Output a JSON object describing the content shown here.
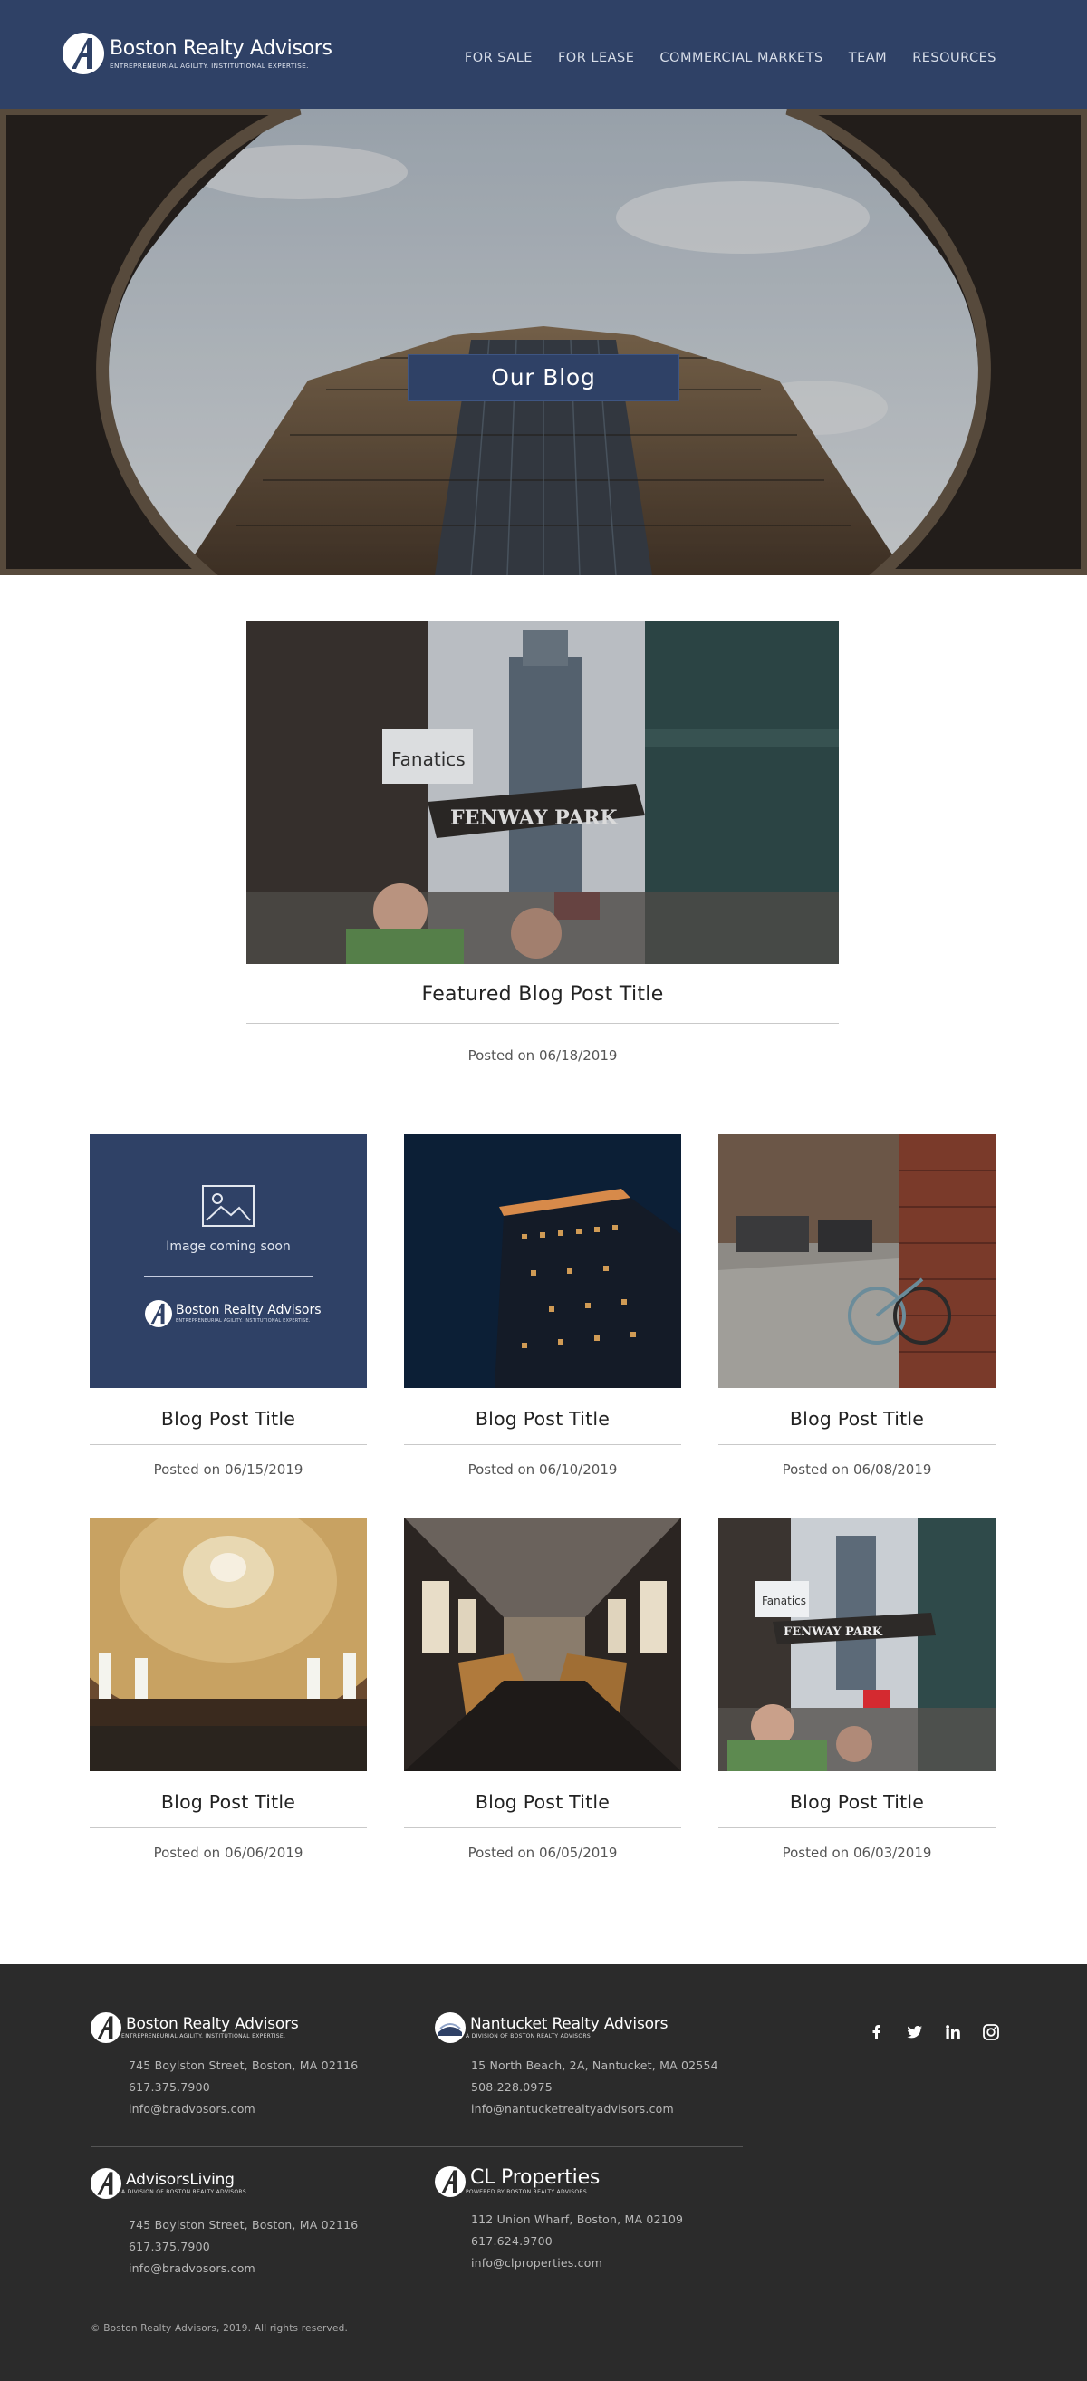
{
  "header": {
    "brand_name": "Boston Realty Advisors",
    "brand_tagline": "ENTREPRENEURIAL AGILITY. INSTITUTIONAL EXPERTISE.",
    "nav": [
      "FOR SALE",
      "FOR LEASE",
      "COMMERCIAL MARKETS",
      "TEAM",
      "RESOURCES"
    ]
  },
  "hero": {
    "title": "Our Blog"
  },
  "featured": {
    "title": "Featured Blog Post Title",
    "date": "Posted on 06/18/2019"
  },
  "posts": [
    {
      "title": "Blog Post Title",
      "date": "Posted on 06/15/2019",
      "image": "image-coming-soon-placeholder"
    },
    {
      "title": "Blog Post Title",
      "date": "Posted on 06/10/2019",
      "image": "night-building-photo"
    },
    {
      "title": "Blog Post Title",
      "date": "Posted on 06/08/2019",
      "image": "bicycle-alley-photo"
    },
    {
      "title": "Blog Post Title",
      "date": "Posted on 06/06/2019",
      "image": "domed-hall-photo"
    },
    {
      "title": "Blog Post Title",
      "date": "Posted on 06/05/2019",
      "image": "train-interior-photo"
    },
    {
      "title": "Blog Post Title",
      "date": "Posted on 06/03/2019",
      "image": "fenway-street-photo"
    }
  ],
  "placeholder": {
    "text": "Image coming soon",
    "brand_name": "Boston Realty Advisors",
    "brand_tagline": "ENTREPRENEURIAL AGILITY. INSTITUTIONAL EXPERTISE."
  },
  "footer": {
    "bra": {
      "name": "Boston Realty Advisors",
      "sub": "ENTREPRENEURIAL AGILITY. INSTITUTIONAL EXPERTISE.",
      "address": "745 Boylston Street, Boston, MA 02116",
      "phone": "617.375.7900",
      "email": "info@bradvosors.com"
    },
    "nra": {
      "name": "Nantucket Realty Advisors",
      "sub": "A DIVISION OF BOSTON REALTY ADVISORS",
      "address": "15 North Beach, 2A, Nantucket, MA 02554",
      "phone": "508.228.0975",
      "email": "info@nantucketrealtyadvisors.com"
    },
    "al": {
      "name": "AdvisorsLiving",
      "sub": "A DIVISION OF BOSTON REALTY ADVISORS",
      "address": "745 Boylston Street, Boston, MA 02116",
      "phone": "617.375.7900",
      "email": "info@bradvosors.com"
    },
    "clp": {
      "name": "CL Properties",
      "sub": "POWERED BY BOSTON REALTY ADVISORS",
      "address": "112 Union Wharf, Boston, MA 02109",
      "phone": "617.624.9700",
      "email": "info@clproperties.com"
    },
    "social": [
      "facebook-icon",
      "twitter-icon",
      "linkedin-icon",
      "instagram-icon"
    ],
    "copyright": "Boston Realty Advisors, 2019.  All rights reserved.",
    "copyright_symbol": "©"
  },
  "colors": {
    "brand_navy": "#2f4166",
    "footer_bg": "#2b2b2b"
  }
}
